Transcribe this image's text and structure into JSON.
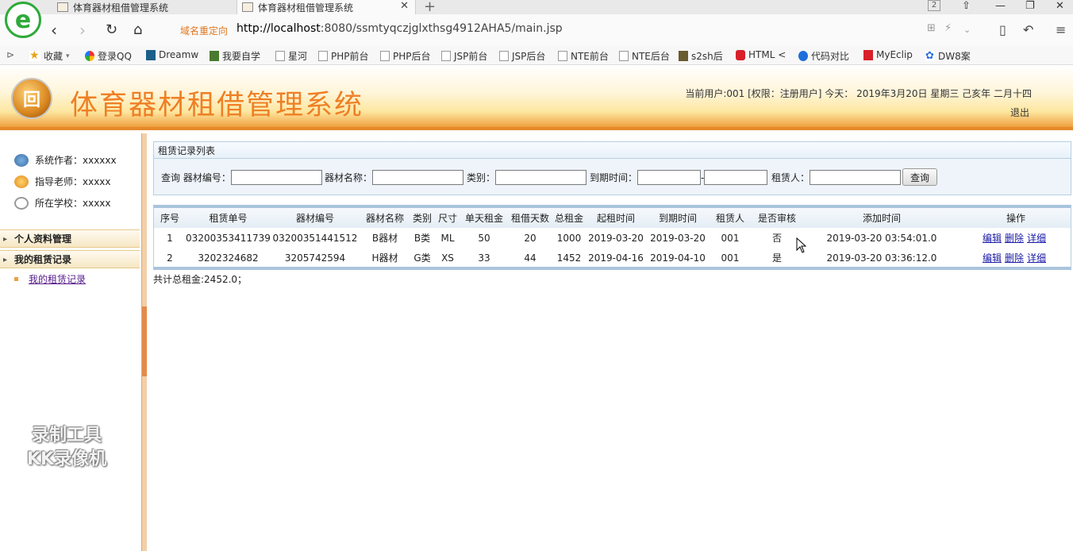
{
  "browser": {
    "tabs": [
      {
        "title": "体育器材租借管理系统"
      },
      {
        "title": "体育器材租借管理系统"
      }
    ],
    "tab_count": "2",
    "redirect_label": "域名重定向",
    "url_host": "http://localhost",
    "url_rest": ":8080/ssmtyqczjglxthsg4912AHA5/main.jsp",
    "bookmarks": [
      {
        "label": "收藏",
        "icon": "star-icon"
      },
      {
        "label": "登录QQ",
        "icon": "globe-icon"
      },
      {
        "label": "Dreamw",
        "icon": "dreamweaver-icon"
      },
      {
        "label": "我要自学",
        "icon": "book-icon"
      },
      {
        "label": "星河",
        "icon": "page-icon"
      },
      {
        "label": "PHP前台",
        "icon": "page-icon"
      },
      {
        "label": "PHP后台",
        "icon": "page-icon"
      },
      {
        "label": "JSP前台",
        "icon": "page-icon"
      },
      {
        "label": "JSP后台",
        "icon": "page-icon"
      },
      {
        "label": "NTE前台",
        "icon": "page-icon"
      },
      {
        "label": "NTE后台",
        "icon": "page-icon"
      },
      {
        "label": "s2sh后",
        "icon": "image-icon"
      },
      {
        "label": "HTML <",
        "icon": "html-icon"
      },
      {
        "label": "代码对比",
        "icon": "compare-icon"
      },
      {
        "label": "MyEclip",
        "icon": "myeclipse-icon"
      },
      {
        "label": "DW8案",
        "icon": "paw-icon"
      }
    ]
  },
  "header": {
    "logo_text": "回",
    "title": "体育器材租借管理系统",
    "user_info": "当前用户:001 [权限：注册用户] 今天： 2019年3月20日 星期三 己亥年 二月十四",
    "logout": "退出"
  },
  "sidebar": {
    "info": [
      {
        "label": "系统作者：xxxxxx",
        "icon": "users-icon"
      },
      {
        "label": "指导老师：xxxxx",
        "icon": "teacher-icon"
      },
      {
        "label": "所在学校：xxxxx",
        "icon": "clock-icon"
      }
    ],
    "menus": [
      {
        "label": "个人资料管理"
      },
      {
        "label": "我的租赁记录"
      }
    ],
    "submenu": "我的租赁记录",
    "watermark_line1": "录制工具",
    "watermark_line2": "KK录像机"
  },
  "main": {
    "panel_title": "租赁记录列表",
    "search": {
      "prefix": "查询",
      "equip_no_label": "器材编号：",
      "equip_name_label": "器材名称：",
      "category_label": "类别：",
      "due_label": "到期时间：",
      "due_sep": "-",
      "renter_label": "租赁人：",
      "button": "查询"
    },
    "columns": [
      "序号",
      "租赁单号",
      "器材编号",
      "器材名称",
      "类别",
      "尺寸",
      "单天租金",
      "租借天数",
      "总租金",
      "起租时间",
      "到期时间",
      "租赁人",
      "是否审核",
      "添加时间",
      "操作"
    ],
    "rows": [
      {
        "no": "1",
        "order": "03200353411739",
        "equip_no": "03200351441512",
        "name": "B器材",
        "category": "B类",
        "size": "ML",
        "daily": "50",
        "days": "20",
        "total": "1000",
        "start": "2019-03-20",
        "due": "2019-03-20",
        "renter": "001",
        "audited": "否",
        "added": "2019-03-20 03:54:01.0"
      },
      {
        "no": "2",
        "order": "3202324682",
        "equip_no": "3205742594",
        "name": "H器材",
        "category": "G类",
        "size": "XS",
        "daily": "33",
        "days": "44",
        "total": "1452",
        "start": "2019-04-16",
        "due": "2019-04-10",
        "renter": "001",
        "audited": "是",
        "added": "2019-03-20 03:36:12.0"
      }
    ],
    "actions": {
      "edit": "编辑",
      "delete": "删除",
      "detail": "详细"
    },
    "total_text": "共计总租金:2452.0；"
  },
  "colors": {
    "accent": "#ef7f25",
    "header_border": "#e58a2a",
    "grid_border": "#a9c4dc",
    "link": "#1a1aa6"
  }
}
